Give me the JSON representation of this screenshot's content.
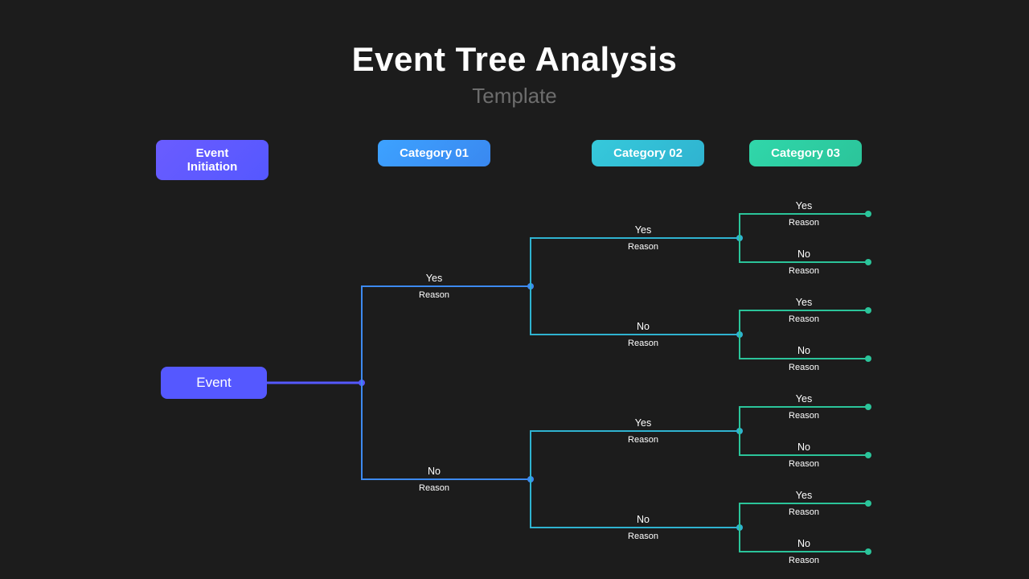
{
  "title": "Event Tree Analysis",
  "subtitle": "Template",
  "categories": {
    "init": "Event Initiation",
    "c1": "Category 01",
    "c2": "Category 02",
    "c3": "Category 03"
  },
  "root": "Event",
  "labels": {
    "yes": "Yes",
    "no": "No",
    "reason": "Reason"
  },
  "colors": {
    "init": "#5558ff",
    "c1": "#3d8af0",
    "c2": "#2fb3d0",
    "c3": "#2bc49a"
  },
  "chart_data": {
    "type": "tree",
    "root": "Event",
    "levels": [
      "Category 01",
      "Category 02",
      "Category 03"
    ],
    "branches": [
      {
        "path": [
          "Yes",
          "Yes",
          "Yes"
        ]
      },
      {
        "path": [
          "Yes",
          "Yes",
          "No"
        ]
      },
      {
        "path": [
          "Yes",
          "No",
          "Yes"
        ]
      },
      {
        "path": [
          "Yes",
          "No",
          "No"
        ]
      },
      {
        "path": [
          "No",
          "Yes",
          "Yes"
        ]
      },
      {
        "path": [
          "No",
          "Yes",
          "No"
        ]
      },
      {
        "path": [
          "No",
          "No",
          "Yes"
        ]
      },
      {
        "path": [
          "No",
          "No",
          "No"
        ]
      }
    ],
    "branch_label": "Reason"
  }
}
